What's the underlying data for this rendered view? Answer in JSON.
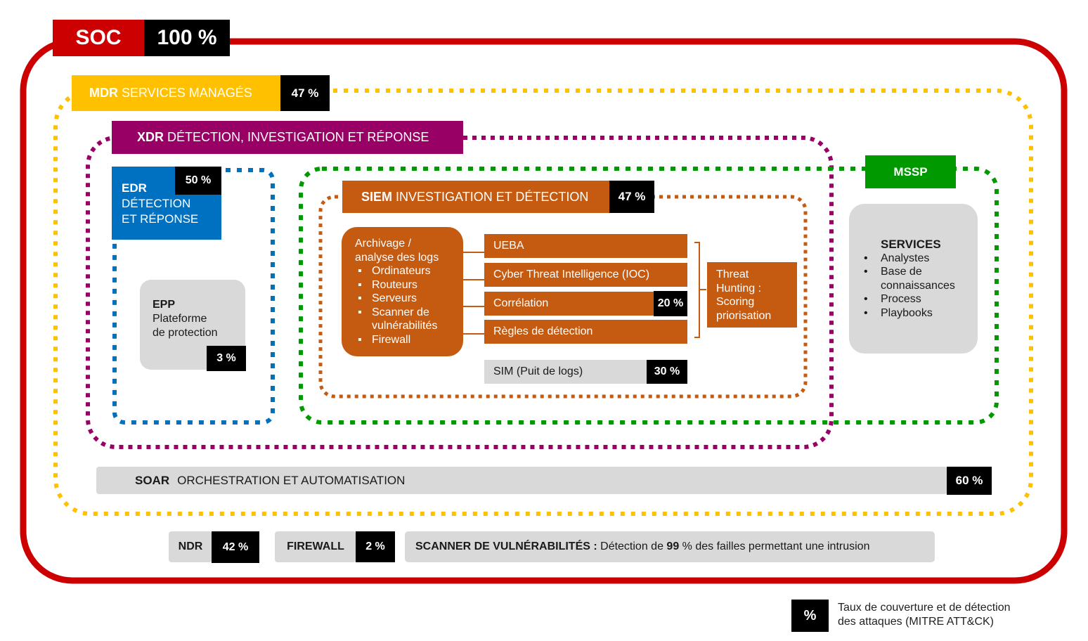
{
  "colors": {
    "soc_red": "#cc0000",
    "mdr_yellow": "#ffc000",
    "xdr_purple": "#990066",
    "edr_blue": "#0070c0",
    "mssp_green": "#009900",
    "siem_orange": "#c55a11",
    "grey_box": "#d9d9d9",
    "percent_black": "#000000"
  },
  "soc": {
    "label": "SOC",
    "percent": "100 %"
  },
  "mdr": {
    "bold": "MDR",
    "label": " SERVICES MANAGÉS",
    "percent": "47 %"
  },
  "xdr": {
    "bold": "XDR",
    "label": " DÉTECTION, INVESTIGATION ET RÉPONSE"
  },
  "edr": {
    "bold": "EDR",
    "line1": "DÉTECTION",
    "line2": "ET RÉPONSE",
    "percent": "50 %"
  },
  "epp": {
    "bold": "EPP",
    "line1": "Plateforme",
    "line2": "de protection",
    "percent": "3 %"
  },
  "siem": {
    "bold": "SIEM",
    "label": " INVESTIGATION ET DÉTECTION",
    "percent": "47 %",
    "archive": {
      "title_line1": "Archivage /",
      "title_line2": "analyse des logs",
      "items": [
        "Ordinateurs",
        "Routeurs",
        "Serveurs",
        "Scanner de vulnérabilités",
        "Firewall"
      ]
    },
    "modules": [
      {
        "label": "UEBA",
        "percent": null
      },
      {
        "label": "Cyber Threat Intelligence (IOC)",
        "percent": null
      },
      {
        "label": "Corrélation",
        "percent": "20 %"
      },
      {
        "label": "Règles de détection",
        "percent": null
      }
    ],
    "sim": {
      "label": "SIM (Puit de logs)",
      "percent": "30 %"
    },
    "threat_hunting": {
      "line1": "Threat",
      "line2": "Hunting :",
      "line3": "Scoring",
      "line4": "priorisation"
    }
  },
  "mssp": {
    "label": "MSSP",
    "services": {
      "title": "SERVICES",
      "items": [
        "Analystes",
        "Base de connaissances",
        "Process",
        "Playbooks"
      ]
    }
  },
  "soar": {
    "bold": "SOAR",
    "label": "ORCHESTRATION ET AUTOMATISATION",
    "percent": "60 %"
  },
  "bottom": {
    "ndr": {
      "label": "NDR",
      "percent": "42 %"
    },
    "firewall": {
      "label": "FIREWALL",
      "percent": "2 %"
    },
    "scanner": {
      "bold": "SCANNER DE VULNÉRABILITÉS :",
      "text_before": " Détection de ",
      "value": "99",
      "text_after": " % des failles permettant une intrusion"
    }
  },
  "legend": {
    "symbol": "%",
    "line1": "Taux de couverture et de détection",
    "line2": "des attaques (MITRE ATT&CK)"
  }
}
